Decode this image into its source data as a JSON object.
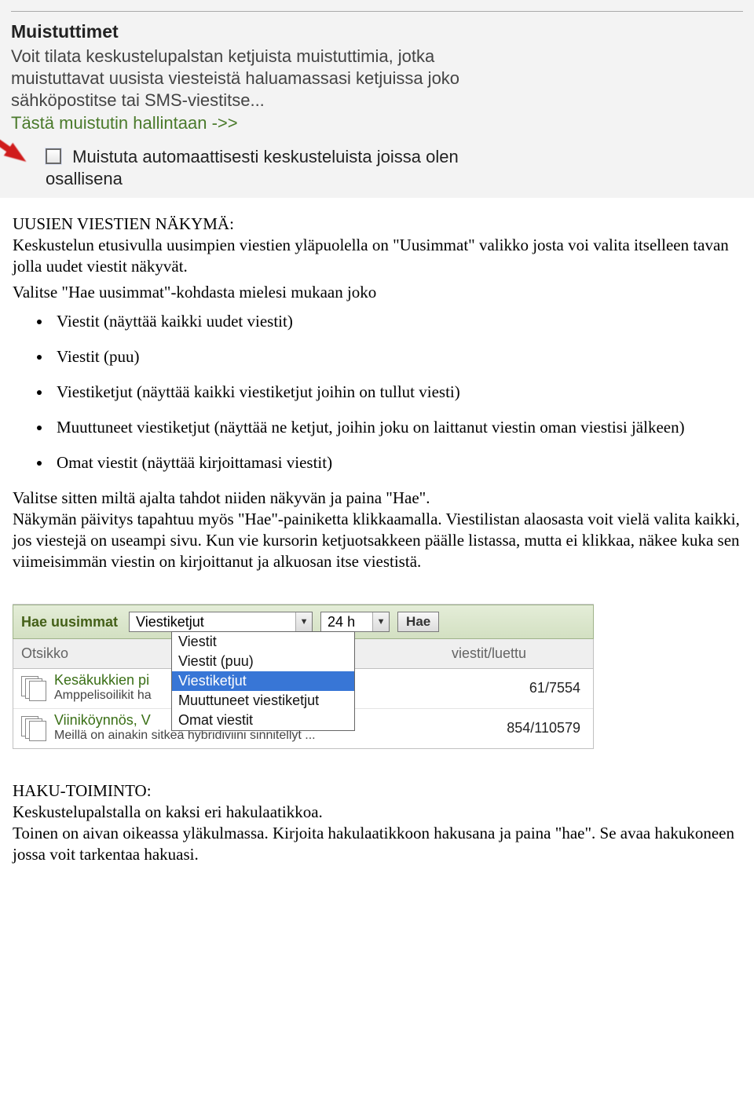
{
  "shot1": {
    "title": "Muistuttimet",
    "body": "Voit tilata keskustelupalstan ketjuista muistuttimia, jotka muistuttavat uusista viesteistä haluamassasi ketjuissa joko sähköpostitse tai SMS-viestitse...",
    "link": "Tästä muistutin hallintaan ->>",
    "checkbox_label": "Muistuta automaattisesti keskusteluista joissa olen osallisena"
  },
  "doc1": {
    "heading": "UUSIEN VIESTIEN NÄKYMÄ:",
    "intro": "Keskustelun etusivulla uusimpien viestien yläpuolella on \"Uusimmat\" valikko josta voi valita itselleen tavan jolla uudet viestit näkyvät.",
    "list_intro": "Valitse \"Hae uusimmat\"-kohdasta mielesi mukaan joko",
    "options": [
      "Viestit (näyttää kaikki uudet viestit)",
      "Viestit (puu)",
      "Viestiketjut (näyttää kaikki viestiketjut joihin on tullut viesti)",
      "Muuttuneet viestiketjut (näyttää ne ketjut, joihin joku on laittanut viestin oman viestisi jälkeen)",
      "Omat viestit (näyttää  kirjoittamasi viestit)"
    ],
    "footer": "Valitse sitten miltä ajalta tahdot niiden näkyvän ja paina \"Hae\".\nNäkymän päivitys tapahtuu  myös  \"Hae\"-painiketta klikkaamalla. Viestilistan alaosasta voit vielä valita kaikki, jos viestejä on useampi sivu. Kun vie kursorin ketjuotsakkeen päälle listassa, mutta ei klikkaa, näkee kuka sen viimeisimmän viestin on kirjoittanut ja alkuosan itse viestistä."
  },
  "shot2": {
    "toolbar_label": "Hae uusimmat",
    "dd_type_value": "Viestiketjut",
    "dd_type_options": [
      "Viestit",
      "Viestit (puu)",
      "Viestiketjut",
      "Muuttuneet viestiketjut",
      "Omat viestit"
    ],
    "dd_time_value": "24 h",
    "search_button": "Hae",
    "col_title": "Otsikko",
    "col_count": "viestit/luettu",
    "items": [
      {
        "title": "Kesäkukkien pi",
        "sub": "Amppelisoilikit ha",
        "count": "61/7554"
      },
      {
        "title": "Viiniköynnös, V",
        "sub": "Meillä on ainakin sitkeä hybridiviini sinnitellyt ...",
        "count": "854/110579"
      }
    ]
  },
  "doc2": {
    "heading": "HAKU-TOIMINTO:",
    "line1": "Keskustelupalstalla on kaksi eri hakulaatikkoa.",
    "line2": "Toinen on aivan oikeassa yläkulmassa. Kirjoita hakulaatikkoon hakusana ja paina \"hae\". Se avaa hakukoneen jossa voit tarkentaa hakuasi."
  }
}
